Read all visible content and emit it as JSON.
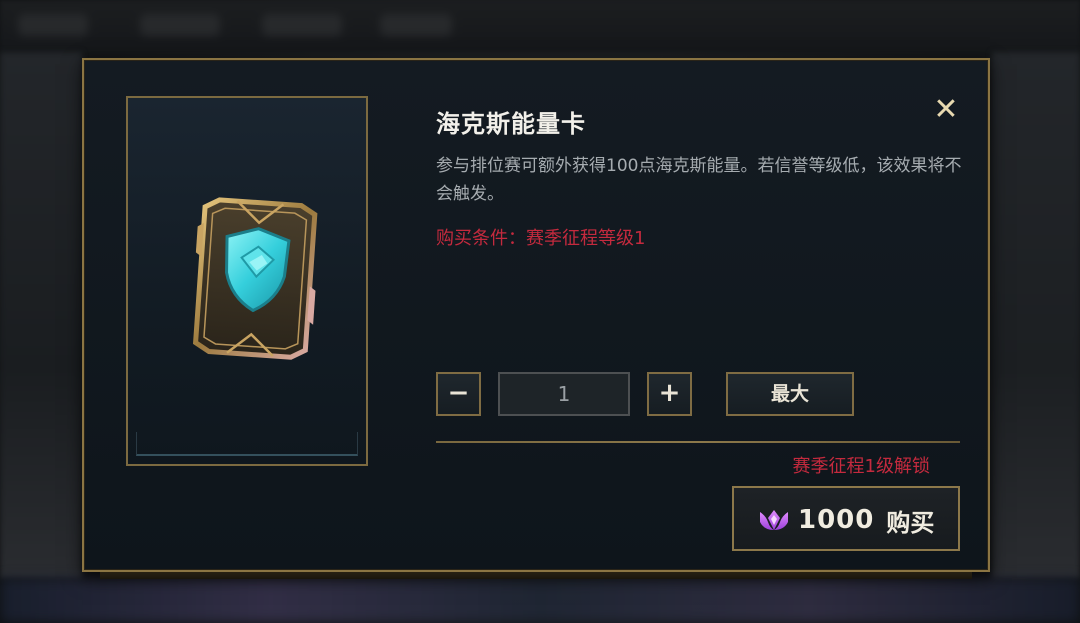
{
  "item": {
    "title": "海克斯能量卡",
    "description": "参与排位赛可额外获得100点海克斯能量。若信誉等级低，该效果将不会触发。",
    "purchase_condition": "购买条件：赛季征程等级1",
    "icon": "hextech-energy-card-icon"
  },
  "quantity": {
    "minus_label": "−",
    "value": "1",
    "plus_label": "+",
    "max_label": "最大"
  },
  "unlock_text": "赛季征程1级解锁",
  "buy_button": {
    "currency_icon": "blue-essence-icon",
    "price": "1000",
    "label": "购买"
  },
  "close_label": "✕",
  "colors": {
    "gold_border": "#8b7543",
    "requirement_red": "#c42a3e",
    "card_teal": "#3fd6e0"
  }
}
